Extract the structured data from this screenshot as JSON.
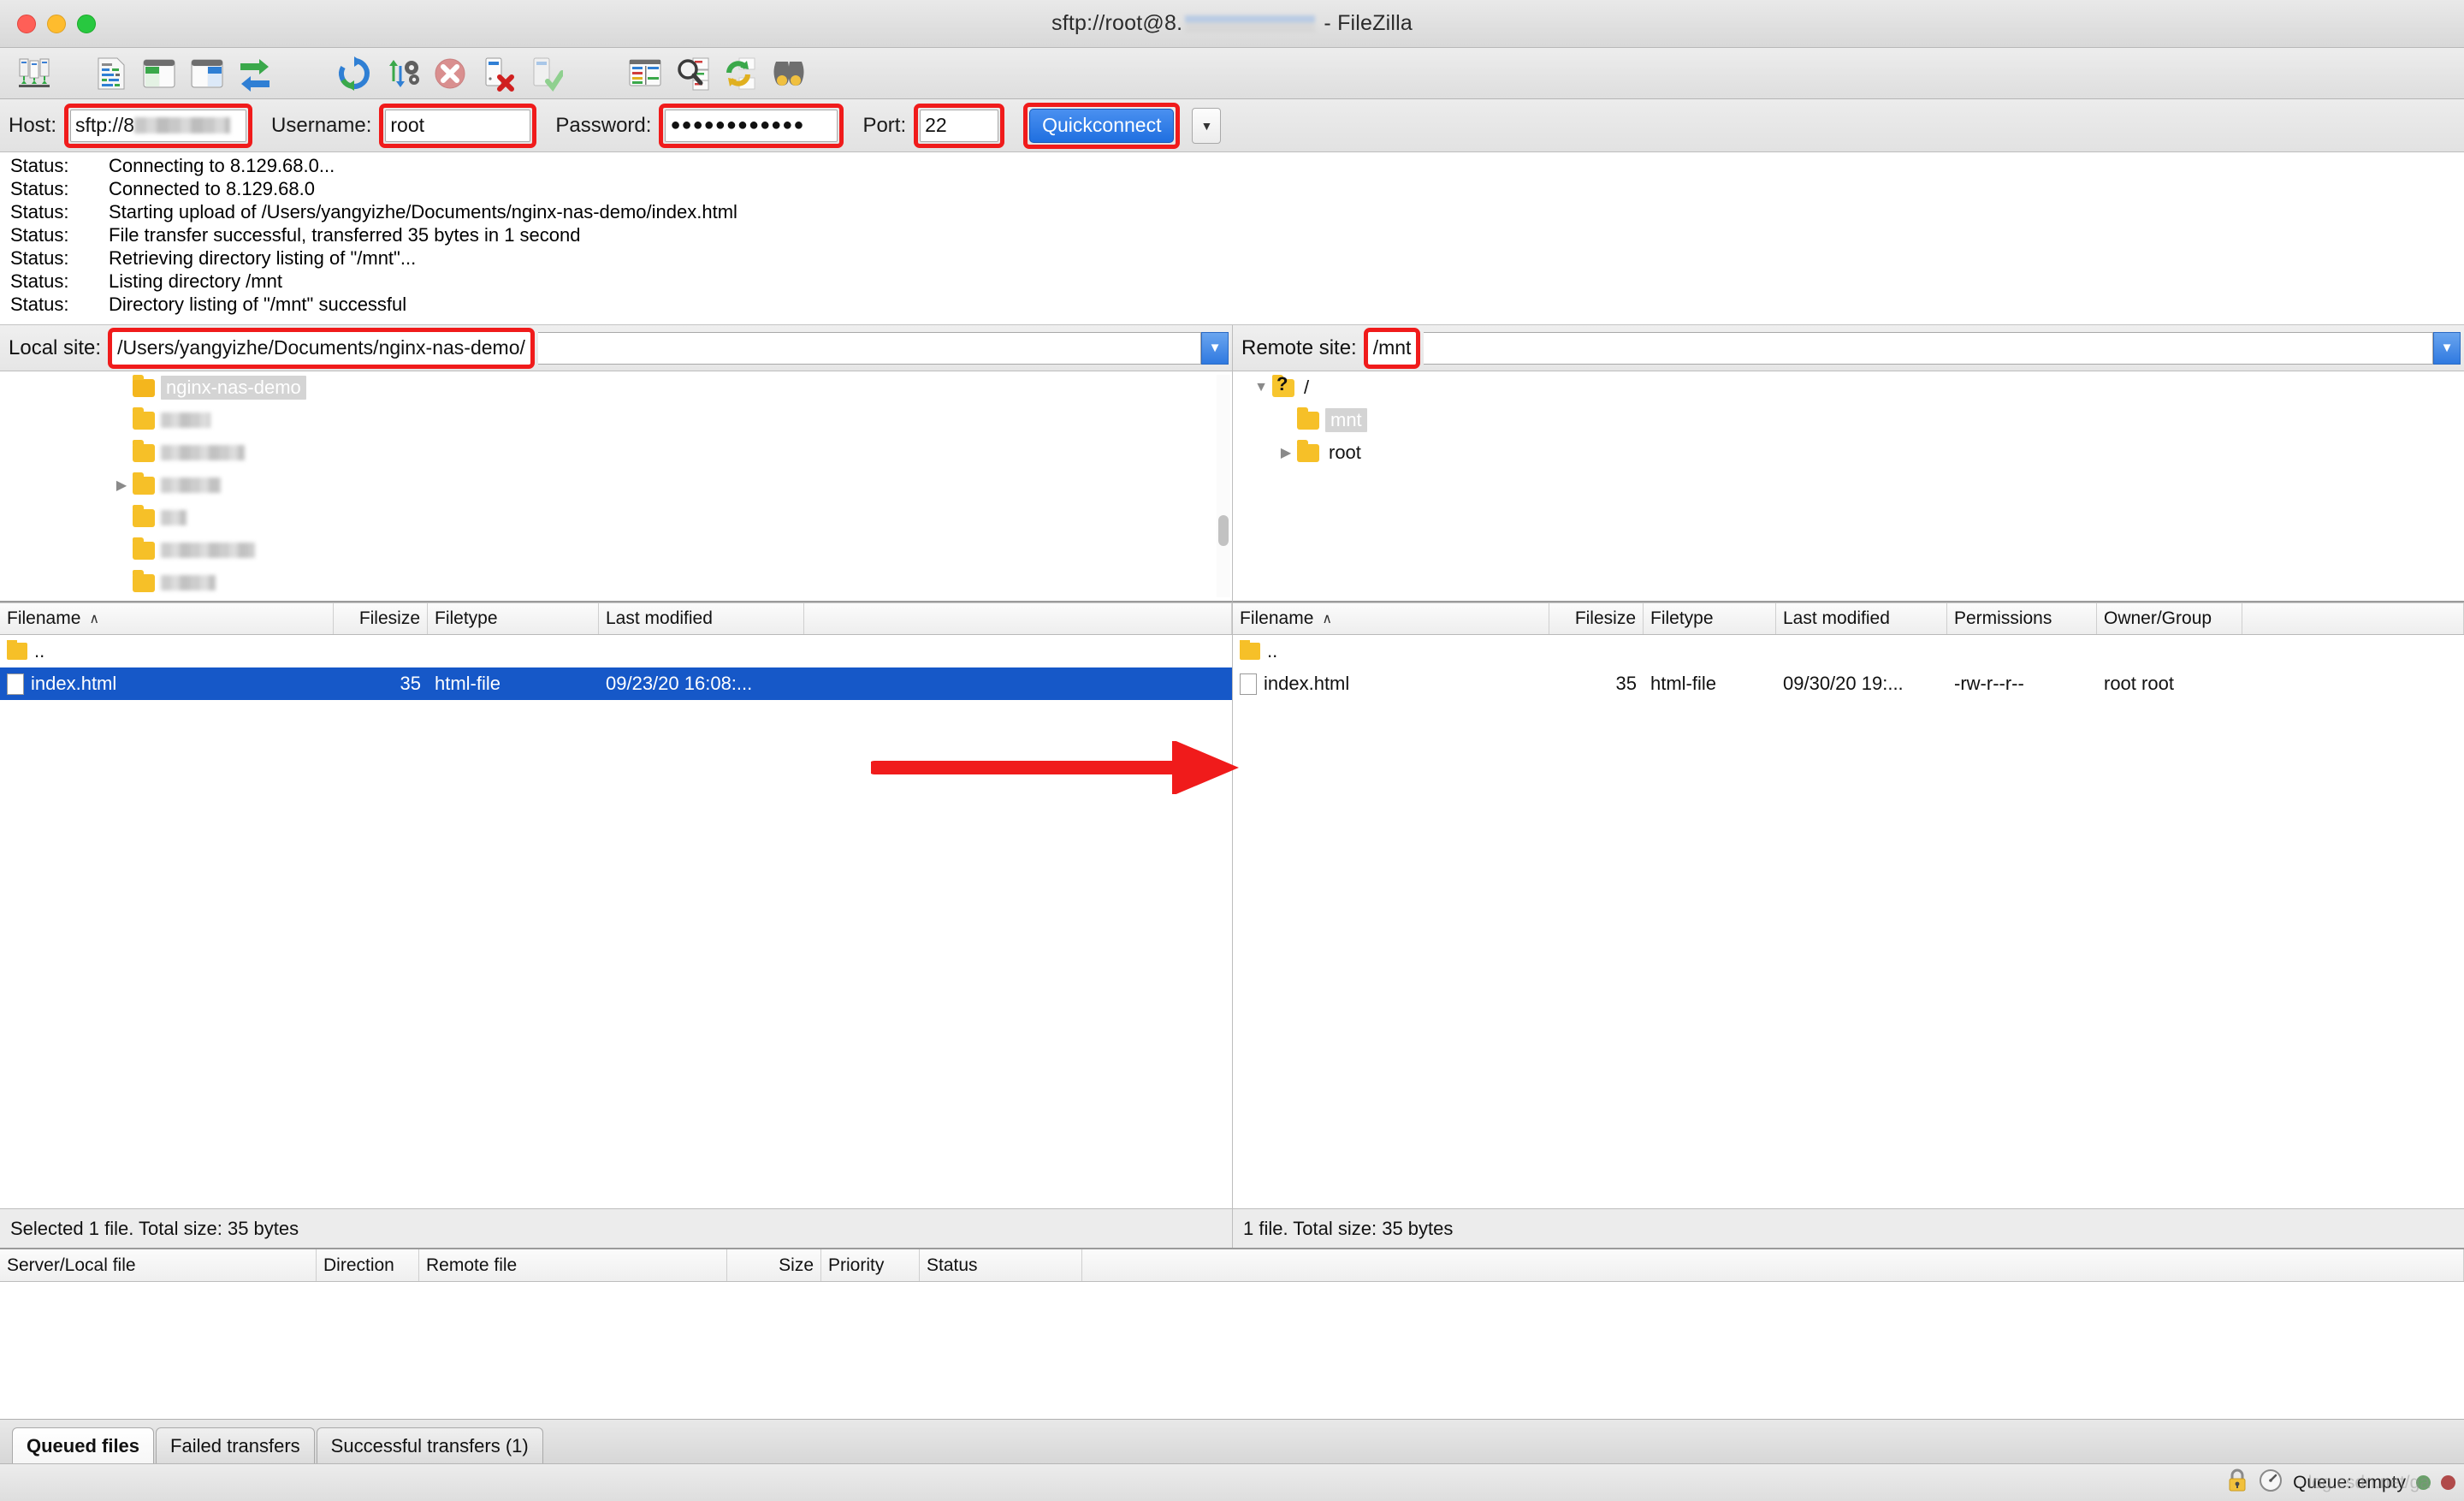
{
  "window": {
    "title_prefix": "sftp://root@8.",
    "title_suffix": " - FileZilla",
    "traffic_lights": [
      "close",
      "minimize",
      "zoom"
    ]
  },
  "toolbar": {
    "buttons": [
      {
        "name": "site-manager-icon",
        "tip": "Open the Site Manager"
      },
      {
        "name": "toggle-message-log-icon",
        "tip": "Toggles the display of the message log"
      },
      {
        "name": "toggle-local-tree-icon",
        "tip": "Toggles the display of the local directory tree"
      },
      {
        "name": "toggle-remote-tree-icon",
        "tip": "Toggles the display of the remote directory tree"
      },
      {
        "name": "toggle-transfer-queue-icon",
        "tip": "Toggles the display of the transfer queue"
      },
      {
        "name": "refresh-icon",
        "tip": "Refresh the file and folder lists"
      },
      {
        "name": "process-queue-icon",
        "tip": "Process queue"
      },
      {
        "name": "cancel-operation-icon",
        "tip": "Cancel current operation"
      },
      {
        "name": "disconnect-icon",
        "tip": "Disconnect from server"
      },
      {
        "name": "reconnect-icon",
        "tip": "Reconnect to last used server"
      },
      {
        "name": "filter-icon",
        "tip": "Open directory listing filters"
      },
      {
        "name": "compare-directories-icon",
        "tip": "Toggle directory comparison"
      },
      {
        "name": "synchronized-browsing-icon",
        "tip": "Toggle synchronized browsing"
      },
      {
        "name": "find-files-icon",
        "tip": "Search for files recursively"
      }
    ]
  },
  "quickconnect": {
    "host_label": "Host:",
    "host_value": "sftp://8",
    "username_label": "Username:",
    "username_value": "root",
    "password_label": "Password:",
    "password_value": "●●●●●●●●●●●●",
    "port_label": "Port:",
    "port_value": "22",
    "connect_label": "Quickconnect",
    "dropdown_icon": "▼"
  },
  "message_log": {
    "prefix": "Status:",
    "lines": [
      "Connecting to 8.129.68.0...",
      "Connected to 8.129.68.0",
      "Starting upload of /Users/yangyizhe/Documents/nginx-nas-demo/index.html",
      "File transfer successful, transferred 35 bytes in 1 second",
      "Retrieving directory listing of \"/mnt\"...",
      "Listing directory /mnt",
      "Directory listing of \"/mnt\" successful"
    ]
  },
  "local": {
    "site_label": "Local site:",
    "site_value": "/Users/yangyizhe/Documents/nginx-nas-demo/",
    "tree": [
      {
        "label": "nginx-nas-demo",
        "selected": true,
        "blurred": false,
        "expandable": false,
        "blur_width": 0
      },
      {
        "label": "",
        "selected": false,
        "blurred": true,
        "expandable": false,
        "blur_width": 58
      },
      {
        "label": "",
        "selected": false,
        "blurred": true,
        "expandable": false,
        "blur_width": 98
      },
      {
        "label": "",
        "selected": false,
        "blurred": true,
        "expandable": true,
        "blur_width": 70
      },
      {
        "label": "",
        "selected": false,
        "blurred": true,
        "expandable": false,
        "blur_width": 30
      },
      {
        "label": "",
        "selected": false,
        "blurred": true,
        "expandable": false,
        "blur_width": 110
      },
      {
        "label": "",
        "selected": false,
        "blurred": true,
        "expandable": false,
        "blur_width": 64
      },
      {
        "label": "",
        "selected": false,
        "blurred": true,
        "expandable": false,
        "blur_width": 140
      },
      {
        "label": "",
        "selected": false,
        "blurred": true,
        "expandable": false,
        "blur_width": 70
      }
    ],
    "columns": [
      "Filename",
      "Filesize",
      "Filetype",
      "Last modified"
    ],
    "sort_indicator": "∧",
    "rows": [
      {
        "icon": "folder",
        "filename": "..",
        "filesize": "",
        "filetype": "",
        "modified": "",
        "selected": false
      },
      {
        "icon": "file",
        "filename": "index.html",
        "filesize": "35",
        "filetype": "html-file",
        "modified": "09/23/20 16:08:...",
        "selected": true
      }
    ],
    "status": "Selected 1 file. Total size: 35 bytes"
  },
  "remote": {
    "site_label": "Remote site:",
    "site_value": "/mnt",
    "tree": [
      {
        "label": "/",
        "icon": "question-folder",
        "indent": 0,
        "twisty": "down",
        "selected": false
      },
      {
        "label": "mnt",
        "icon": "folder",
        "indent": 1,
        "twisty": "none",
        "selected": true
      },
      {
        "label": "root",
        "icon": "folder",
        "indent": 1,
        "twisty": "right",
        "selected": false
      }
    ],
    "columns": [
      "Filename",
      "Filesize",
      "Filetype",
      "Last modified",
      "Permissions",
      "Owner/Group"
    ],
    "sort_indicator": "∧",
    "rows": [
      {
        "icon": "folder",
        "filename": "..",
        "filesize": "",
        "filetype": "",
        "modified": "",
        "permissions": "",
        "owner": "",
        "selected": false
      },
      {
        "icon": "file",
        "filename": "index.html",
        "filesize": "35",
        "filetype": "html-file",
        "modified": "09/30/20 19:...",
        "permissions": "-rw-r--r--",
        "owner": "root root",
        "selected": false
      }
    ],
    "status": "1 file. Total size: 35 bytes"
  },
  "queue": {
    "columns": [
      "Server/Local file",
      "Direction",
      "Remote file",
      "",
      "Size",
      "Priority",
      "Status"
    ],
    "rows": []
  },
  "tabs": [
    {
      "label": "Queued files",
      "active": true
    },
    {
      "label": "Failed transfers",
      "active": false
    },
    {
      "label": "Successful transfers (1)",
      "active": false
    }
  ],
  "statusbar": {
    "lock_icon": "lock-icon",
    "speed_icon": "speed-gauge-icon",
    "queue_text": "Queue: empty",
    "watermark": "log.csdn.net/ga",
    "indicator_green": "#6aa06a",
    "indicator_red": "#b04a4a"
  },
  "annotation": {
    "arrow_color": "#f01b1b",
    "highlight_color": "#f01b1b"
  }
}
